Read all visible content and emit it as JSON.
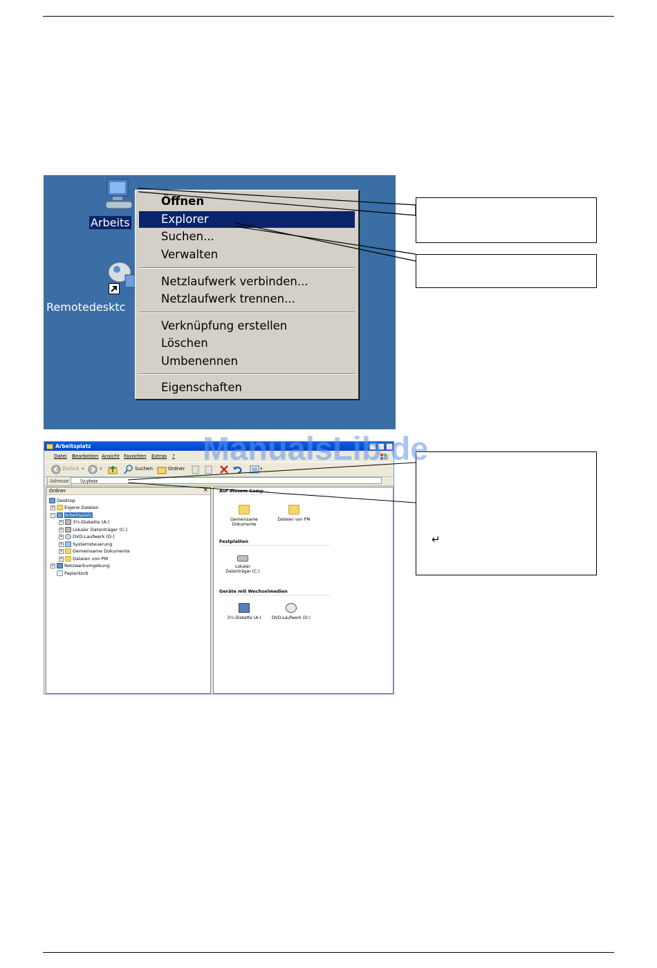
{
  "desktop": {
    "icons": [
      {
        "name": "arbeitsplatz",
        "label": "Arbeits",
        "icon": "computer-icon"
      },
      {
        "name": "remotedesktop",
        "label": "Remotedesktc",
        "icon": "remote-desktop-icon"
      }
    ],
    "context_menu": {
      "groups": [
        [
          {
            "label": "Öffnen",
            "bold": true
          },
          {
            "label": "Explorer",
            "highlighted": true
          },
          {
            "label": "Suchen..."
          },
          {
            "label": "Verwalten"
          }
        ],
        [
          {
            "label": "Netzlaufwerk verbinden..."
          },
          {
            "label": "Netzlaufwerk trennen..."
          }
        ],
        [
          {
            "label": "Verknüpfung erstellen"
          },
          {
            "label": "Löschen"
          },
          {
            "label": "Umbenennen"
          }
        ],
        [
          {
            "label": "Eigenschaften"
          }
        ]
      ]
    }
  },
  "explorer": {
    "title": "Arbeitsplatz",
    "menu": [
      "Datei",
      "Bearbeiten",
      "Ansicht",
      "Favoriten",
      "Extras",
      "?"
    ],
    "toolbar": {
      "back": "Zurück",
      "search": "Suchen",
      "folders": "Ordner"
    },
    "address": {
      "label": "Adresse",
      "value": "\\\\cybox"
    },
    "folder_pane": {
      "title": "Ordner",
      "close": "×",
      "tree": [
        {
          "label": "Desktop",
          "icon": "desktop-icon"
        },
        {
          "label": "Eigene Dateien",
          "icon": "folder-icon"
        },
        {
          "label": "Arbeitsplatz",
          "icon": "computer-icon",
          "selected": true
        },
        {
          "label": "3½-Diskette (A:)",
          "icon": "floppy-icon"
        },
        {
          "label": "Lokaler Datenträger (C:)",
          "icon": "drive-icon"
        },
        {
          "label": "DVD-Laufwerk (D:)",
          "icon": "dvd-icon"
        },
        {
          "label": "Systemsteuerung",
          "icon": "control-panel-icon"
        },
        {
          "label": "Gemeinsame Dokumente",
          "icon": "folder-icon"
        },
        {
          "label": "Dateien von PM",
          "icon": "folder-icon"
        },
        {
          "label": "Netzwerkumgebung",
          "icon": "network-icon"
        },
        {
          "label": "Papierkorb",
          "icon": "recycle-bin-icon"
        }
      ]
    },
    "content": {
      "groups": [
        {
          "title": "Auf diesem Computer gespeicherte Dateien",
          "visible_title": "Auf diesem Comp...",
          "items": [
            {
              "label": "Gemeinsame Dokumente",
              "icon": "folder-icon"
            },
            {
              "label": "Dateien von PM",
              "icon": "folder-icon"
            }
          ]
        },
        {
          "title": "Festplatten",
          "items": [
            {
              "label": "Lokaler Datenträger (C:)",
              "icon": "drive-icon"
            }
          ]
        },
        {
          "title": "Geräte mit Wechselmedien",
          "items": [
            {
              "label": "3½-Diskette (A:)",
              "icon": "floppy-icon"
            },
            {
              "label": "DVD-Laufwerk (D:)",
              "icon": "dvd-icon"
            }
          ]
        }
      ]
    }
  },
  "callouts": {
    "enter_symbol": "↵"
  },
  "watermark": "ManualsLib.de"
}
